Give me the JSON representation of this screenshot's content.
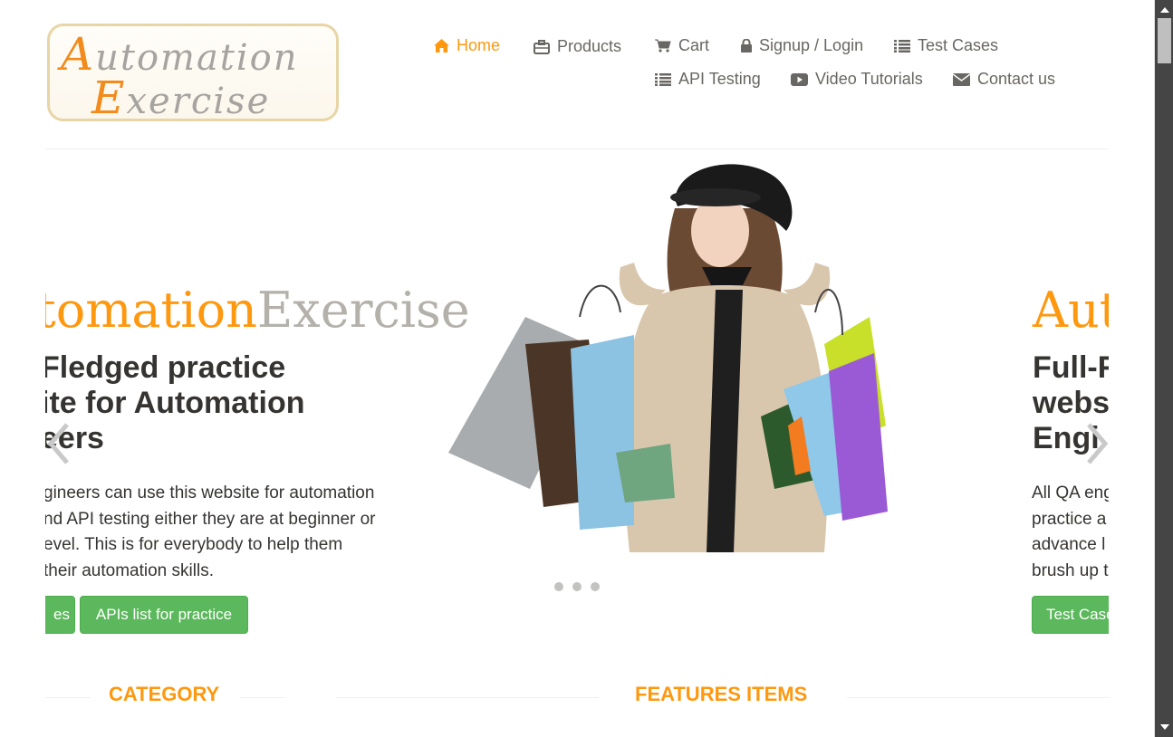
{
  "logo": {
    "line1_cap": "A",
    "line1_rest": "utomation",
    "line2_cap": "E",
    "line2_rest": "xercise"
  },
  "nav": {
    "home": "Home",
    "products": "Products",
    "cart": "Cart",
    "login": "Signup / Login",
    "test_cases": "Test Cases",
    "api_testing": "API Testing",
    "video_tutorials": "Video Tutorials",
    "contact": "Contact us"
  },
  "slider": {
    "left": {
      "title_orange": "tomation",
      "title_gray": "Exercise",
      "heading_lines": [
        "Fledged practice",
        "ite for Automation",
        "eers"
      ],
      "paragraph_lines": [
        "gineers can use this website for automation",
        "nd API testing either they are at beginner or",
        "evel. This is for everybody to help them",
        "their automation skills."
      ],
      "btn_test_cases": "es",
      "btn_apis": "APIs list for practice"
    },
    "right": {
      "title_orange": "Aut",
      "heading_lines": [
        "Full-F",
        "webs",
        "Engi"
      ],
      "paragraph_lines": [
        "All QA eng",
        "practice a",
        "advance l",
        "brush up t"
      ],
      "btn_test_cases": "Test Case"
    },
    "dot_count": 3
  },
  "sections": {
    "category": "CATEGORY",
    "features": "FEATURES ITEMS"
  },
  "colors": {
    "accent": "#FE980F",
    "button_green": "#5CB85C",
    "text_dark": "#363432",
    "nav_text": "#696763"
  }
}
